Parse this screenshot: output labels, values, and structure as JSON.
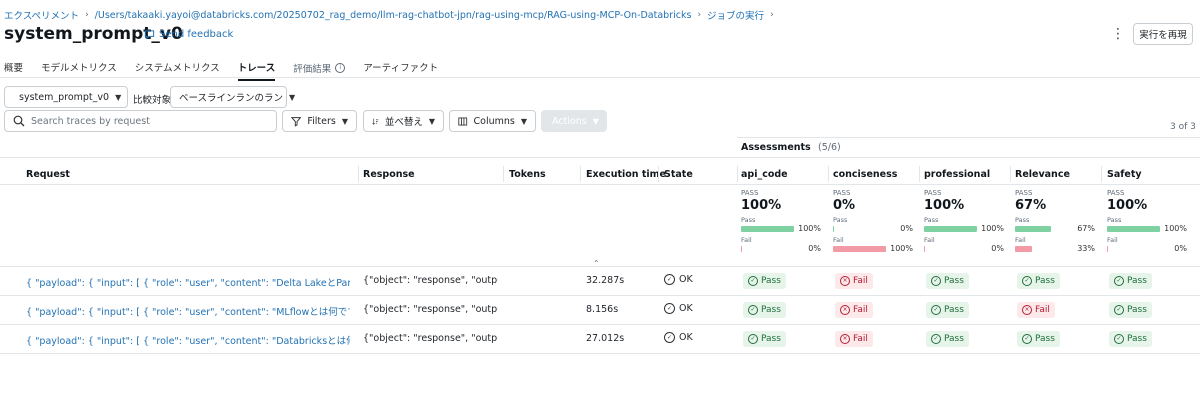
{
  "breadcrumb": {
    "items": [
      "エクスペリメント",
      "/Users/takaaki.yayoi@databricks.com/20250702_rag_demo/llm-rag-chatbot-jpn/rag-using-mcp/RAG-using-MCP-On-Databricks",
      "ジョブの実行"
    ]
  },
  "header": {
    "title": "system_prompt_v0",
    "feedback": "Send feedback",
    "rerun": "実行を再現"
  },
  "tabs": [
    "概要",
    "モデルメトリクス",
    "システムメトリクス",
    "トレース",
    "評価結果",
    "アーティファクト"
  ],
  "toolbar": {
    "run_select": "system_prompt_v0",
    "compare_label": "比較対象",
    "baseline_select": "ベースラインランのラン",
    "search_placeholder": "Search traces by request",
    "filters": "Filters",
    "sort": "並べ替え",
    "columns": "Columns",
    "actions": "Actions",
    "count": "3 of 3"
  },
  "assessments": {
    "label": "Assessments",
    "count": "(5/6)"
  },
  "columns": {
    "request": "Request",
    "response": "Response",
    "tokens": "Tokens",
    "execution_time": "Execution time",
    "state": "State",
    "api_code": "api_code",
    "conciseness": "conciseness",
    "professional": "professional",
    "relevance": "Relevance",
    "safety": "Safety"
  },
  "stats": [
    {
      "pass_label": "PASS",
      "pct": "100%",
      "pass_pct": "100%",
      "pass_frac": 1.0,
      "fail_label": "Fail",
      "fail_pct": "0%",
      "fail_frac": 0.0
    },
    {
      "pass_label": "PASS",
      "pct": "0%",
      "pass_pct": "0%",
      "pass_frac": 0.0,
      "fail_label": "Fail",
      "fail_pct": "100%",
      "fail_frac": 1.0
    },
    {
      "pass_label": "PASS",
      "pct": "100%",
      "pass_pct": "100%",
      "pass_frac": 1.0,
      "fail_label": "Fail",
      "fail_pct": "0%",
      "fail_frac": 0.0
    },
    {
      "pass_label": "PASS",
      "pct": "67%",
      "pass_pct": "67%",
      "pass_frac": 0.67,
      "fail_label": "Fail",
      "fail_pct": "33%",
      "fail_frac": 0.33
    },
    {
      "pass_label": "PASS",
      "pct": "100%",
      "pass_pct": "100%",
      "pass_frac": 1.0,
      "fail_label": "Fail",
      "fail_pct": "0%",
      "fail_frac": 0.0
    }
  ],
  "rows": [
    {
      "request": "{ \"payload\": { \"input\": [ { \"role\": \"user\", \"content\": \"Delta LakeとParquetの違...",
      "response": "{\"object\": \"response\", \"output...",
      "time": "32.287s",
      "state": "OK",
      "assess": [
        "Pass",
        "Fail",
        "Pass",
        "Pass",
        "Pass"
      ]
    },
    {
      "request": "{ \"payload\": { \"input\": [ { \"role\": \"user\", \"content\": \"MLflowとは何ですか？\", \"t...",
      "response": "{\"object\": \"response\", \"output...",
      "time": "8.156s",
      "state": "OK",
      "assess": [
        "Pass",
        "Fail",
        "Pass",
        "Fail",
        "Pass"
      ]
    },
    {
      "request": "{ \"payload\": { \"input\": [ { \"role\": \"user\", \"content\": \"Databricksとは何ですか？\"...",
      "response": "{\"object\": \"response\", \"output...",
      "time": "27.012s",
      "state": "OK",
      "assess": [
        "Pass",
        "Fail",
        "Pass",
        "Pass",
        "Pass"
      ]
    }
  ],
  "colors": {
    "link": "#2272b4",
    "pass_bar": "#7fd1a2",
    "fail_bar": "#f29aa6"
  }
}
